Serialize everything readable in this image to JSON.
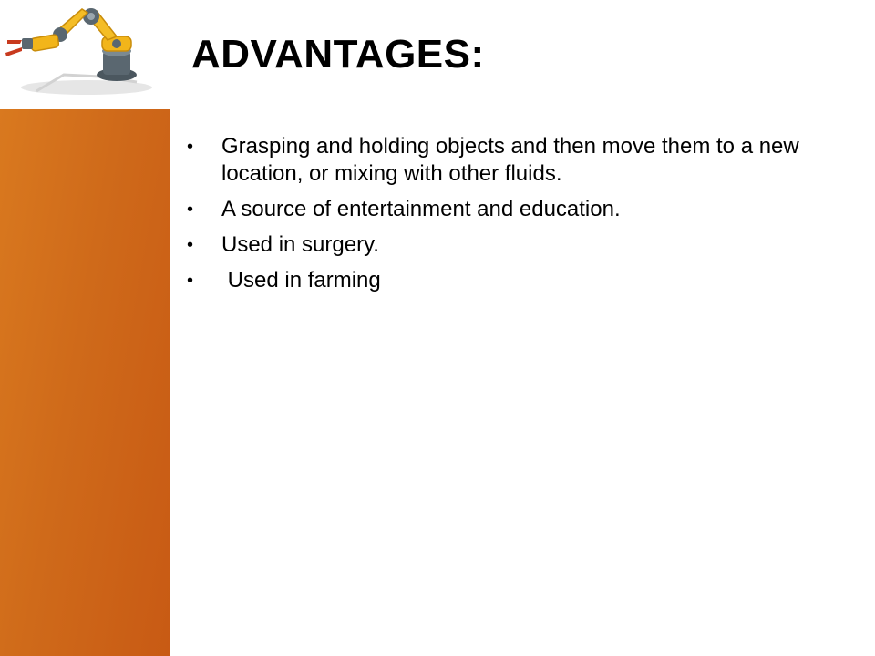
{
  "slide": {
    "title": "ADVANTAGES:",
    "bullet_glyph": "•",
    "bullets": [
      "Grasping and holding objects and then move them to a new location, or mixing with other fluids.",
      "A source of entertainment and education.",
      "Used in surgery.",
      " Used in farming"
    ]
  },
  "theme": {
    "accent_orange": "#d2691b",
    "robot_yellow": "#f2b51a",
    "robot_gray": "#5a6770"
  },
  "logo": {
    "icon": "robot-arm-icon"
  }
}
